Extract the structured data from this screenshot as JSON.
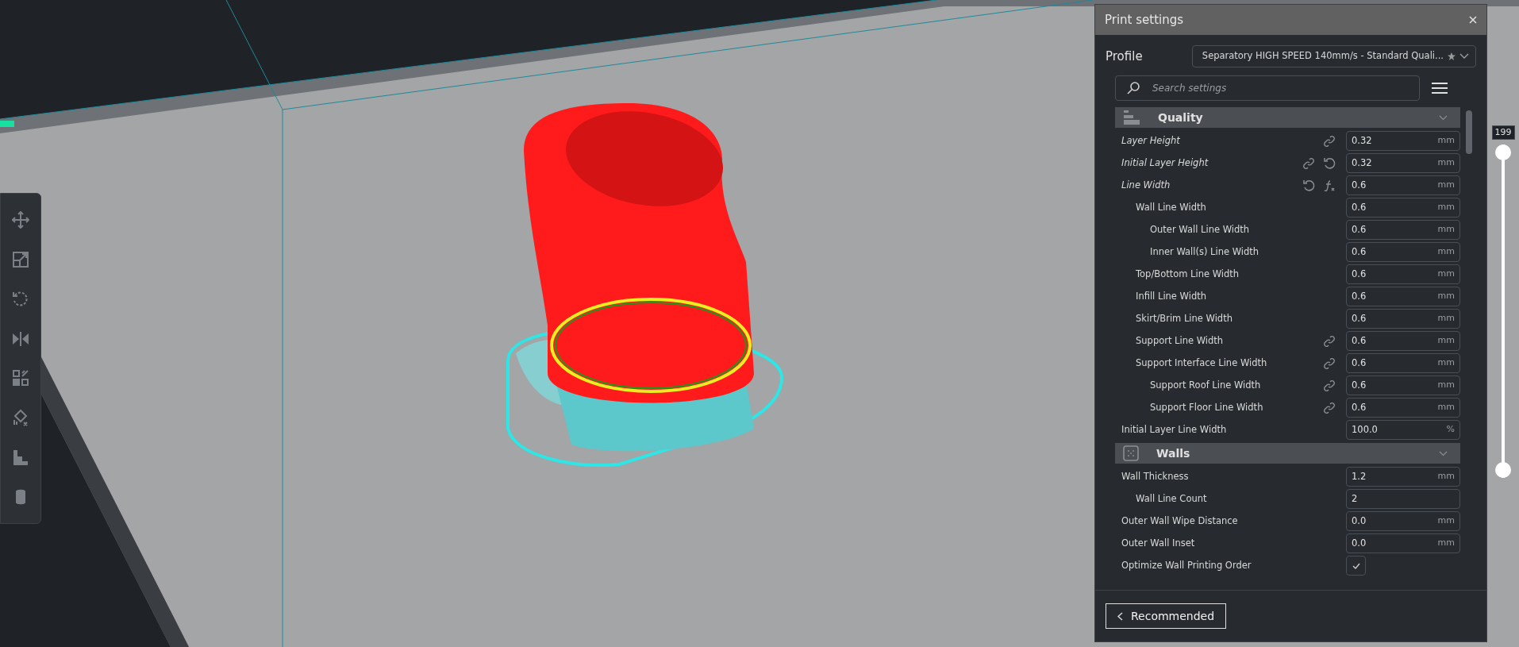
{
  "panel": {
    "title": "Print settings",
    "profile_label": "Profile",
    "profile_value": "Separatory HIGH SPEED 140mm/s - Standard Quali...",
    "search": {
      "placeholder": "Search settings"
    },
    "sections": [
      {
        "title": "Quality",
        "kind": "quality",
        "expanded": true,
        "settings": [
          {
            "label": "Layer Height",
            "kind": "number",
            "value": "0.32",
            "unit": "mm",
            "modified": true,
            "linked": true,
            "resettable": false,
            "formula": false
          },
          {
            "label": "Initial Layer Height",
            "kind": "number",
            "value": "0.32",
            "unit": "mm",
            "modified": true,
            "linked": true,
            "resettable": true,
            "formula": false
          },
          {
            "label": "Line Width",
            "kind": "number",
            "value": "0.6",
            "unit": "mm",
            "modified": true,
            "linked": false,
            "resettable": true,
            "formula": true,
            "children": [
              {
                "label": "Wall Line Width",
                "kind": "number",
                "value": "0.6",
                "unit": "mm",
                "modified": false,
                "linked": false,
                "resettable": false,
                "formula": false,
                "children": [
                  {
                    "label": "Outer Wall Line Width",
                    "kind": "number",
                    "value": "0.6",
                    "unit": "mm",
                    "modified": false,
                    "linked": false,
                    "resettable": false,
                    "formula": false
                  },
                  {
                    "label": "Inner Wall(s) Line Width",
                    "kind": "number",
                    "value": "0.6",
                    "unit": "mm",
                    "modified": false,
                    "linked": false,
                    "resettable": false,
                    "formula": false
                  }
                ]
              },
              {
                "label": "Top/Bottom Line Width",
                "kind": "number",
                "value": "0.6",
                "unit": "mm",
                "modified": false,
                "linked": false,
                "resettable": false,
                "formula": false
              },
              {
                "label": "Infill Line Width",
                "kind": "number",
                "value": "0.6",
                "unit": "mm",
                "modified": false,
                "linked": false,
                "resettable": false,
                "formula": false
              },
              {
                "label": "Skirt/Brim Line Width",
                "kind": "number",
                "value": "0.6",
                "unit": "mm",
                "modified": false,
                "linked": false,
                "resettable": false,
                "formula": false
              },
              {
                "label": "Support Line Width",
                "kind": "number",
                "value": "0.6",
                "unit": "mm",
                "modified": false,
                "linked": true,
                "resettable": false,
                "formula": false
              },
              {
                "label": "Support Interface Line Width",
                "kind": "number",
                "value": "0.6",
                "unit": "mm",
                "modified": false,
                "linked": true,
                "resettable": false,
                "formula": false,
                "children": [
                  {
                    "label": "Support Roof Line Width",
                    "kind": "number",
                    "value": "0.6",
                    "unit": "mm",
                    "modified": false,
                    "linked": true,
                    "resettable": false,
                    "formula": false
                  },
                  {
                    "label": "Support Floor Line Width",
                    "kind": "number",
                    "value": "0.6",
                    "unit": "mm",
                    "modified": false,
                    "linked": true,
                    "resettable": false,
                    "formula": false
                  }
                ]
              }
            ]
          },
          {
            "label": "Initial Layer Line Width",
            "kind": "number",
            "value": "100.0",
            "unit": "%",
            "modified": false,
            "linked": false,
            "resettable": false,
            "formula": false
          }
        ]
      },
      {
        "title": "Walls",
        "kind": "walls",
        "expanded": true,
        "settings": [
          {
            "label": "Wall Thickness",
            "kind": "number",
            "value": "1.2",
            "unit": "mm",
            "modified": false,
            "linked": false,
            "resettable": false,
            "formula": false,
            "children": [
              {
                "label": "Wall Line Count",
                "kind": "number",
                "value": "2",
                "modified": false,
                "linked": false,
                "resettable": false,
                "formula": false
              }
            ]
          },
          {
            "label": "Outer Wall Wipe Distance",
            "kind": "number",
            "value": "0.0",
            "unit": "mm",
            "modified": false,
            "linked": false,
            "resettable": false,
            "formula": false
          },
          {
            "label": "Outer Wall Inset",
            "kind": "number",
            "value": "0.0",
            "unit": "mm",
            "modified": false,
            "linked": false,
            "resettable": false,
            "formula": false
          },
          {
            "label": "Optimize Wall Printing Order",
            "kind": "checkbox",
            "checked": true,
            "modified": false,
            "linked": false,
            "resettable": false,
            "formula": false
          }
        ]
      }
    ],
    "footer_button": "Recommended"
  },
  "layer_slider": {
    "value": "199",
    "handles": [
      {
        "level": 1
      },
      {
        "level": 0
      }
    ]
  }
}
